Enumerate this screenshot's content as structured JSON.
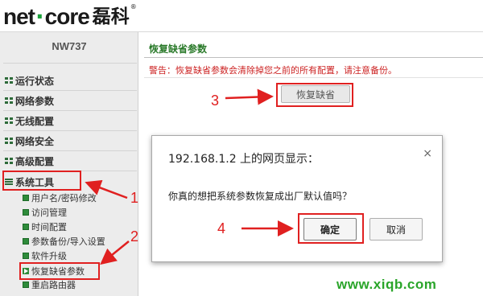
{
  "header": {
    "brand_left": "net",
    "brand_dot": "·",
    "brand_right": "core",
    "brand_cn": "磊科",
    "registered": "®"
  },
  "sidebar": {
    "model": "NW737",
    "menu": [
      {
        "label": "运行状态"
      },
      {
        "label": "网络参数"
      },
      {
        "label": "无线配置"
      },
      {
        "label": "网络安全"
      },
      {
        "label": "高级配置"
      },
      {
        "label": "系统工具"
      }
    ],
    "submenu": [
      {
        "label": "用户名/密码修改"
      },
      {
        "label": "访问管理"
      },
      {
        "label": "时间配置"
      },
      {
        "label": "参数备份/导入设置"
      },
      {
        "label": "软件升级"
      },
      {
        "label": "恢复缺省参数"
      },
      {
        "label": "重启路由器"
      }
    ]
  },
  "main": {
    "section_title": "恢复缺省参数",
    "warning": "警告：恢复缺省参数会清除掉您之前的所有配置，请注意备份。",
    "restore_button": "恢复缺省"
  },
  "dialog": {
    "title": "192.168.1.2 上的网页显示：",
    "close": "×",
    "message": "你真的想把系统参数恢复成出厂默认值吗？",
    "ok_label": "确定",
    "cancel_label": "取消"
  },
  "annotations": {
    "step1": "1",
    "step2": "2",
    "step3": "3",
    "step4": "4"
  },
  "watermark": "www.xiqb.com",
  "colors": {
    "accent_green": "#2e6b3a",
    "annotation_red": "#e02020",
    "warning_red": "#cc2222",
    "watermark_green": "#2aa52a"
  }
}
